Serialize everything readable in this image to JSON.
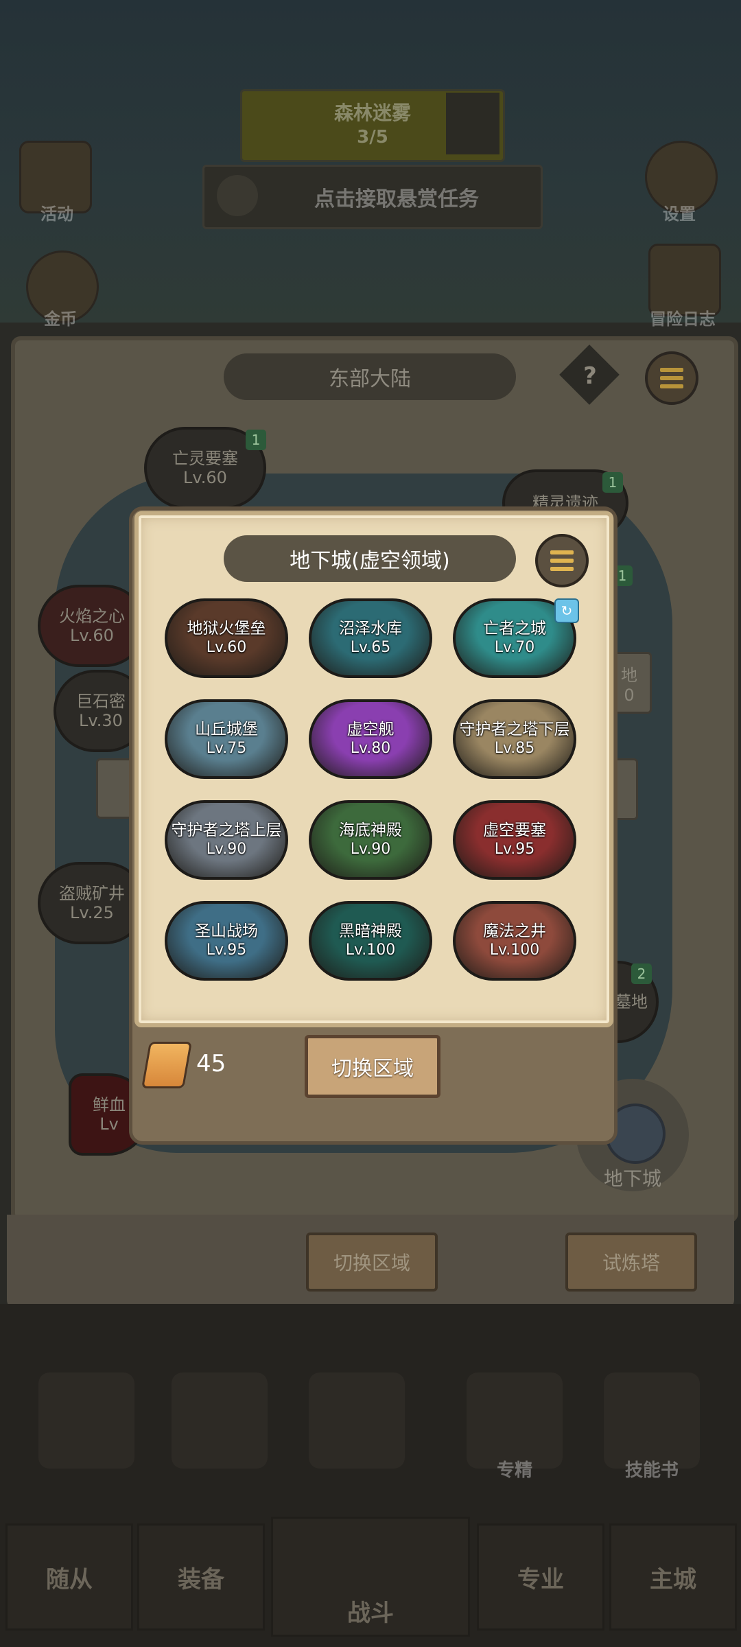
{
  "background": {
    "top_banner_line1": "森林迷雾",
    "top_banner_line2": "3/5",
    "task_bar_text": "点击接取悬赏任务",
    "left_icon_1_label": "活动",
    "left_icon_2_label": "金币",
    "right_icon_1_label": "设置",
    "right_icon_2_label": "冒险日志",
    "map_title": "东部大陆",
    "help_label": "?",
    "map_nodes": [
      {
        "name": "亡灵要塞",
        "level": "Lv.60",
        "badge": "1"
      },
      {
        "name": "精灵遗迹",
        "level": "",
        "badge": "1"
      },
      {
        "name": "火焰之心",
        "level": "Lv.60",
        "badge": ""
      },
      {
        "name": "巨石密",
        "level": "Lv.30",
        "badge": ""
      },
      {
        "name": "盗贼矿井",
        "level": "Lv.25",
        "badge": ""
      },
      {
        "name": "鲜血",
        "level": "Lv",
        "badge": ""
      },
      {
        "name": "地",
        "level": "0",
        "badge": ""
      },
      {
        "name": "墓地",
        "level": "",
        "badge": "2"
      }
    ],
    "dungeon_fab_label": "地下城",
    "lower_buttons": [
      "切换区域",
      "试炼塔"
    ],
    "bottom_skills": [
      "专精",
      "技能书"
    ],
    "nav": [
      "随从",
      "装备",
      "战斗",
      "专业",
      "主城"
    ]
  },
  "modal": {
    "title": "地下城(虚空领域)",
    "dungeons": [
      {
        "name": "地狱火堡垒",
        "level": "Lv.60",
        "color": "#5a3a2a"
      },
      {
        "name": "沼泽水库",
        "level": "Lv.65",
        "color": "#2c6b74"
      },
      {
        "name": "亡者之城",
        "level": "Lv.70",
        "color": "#2f8c8a",
        "badge": "new"
      },
      {
        "name": "山丘城堡",
        "level": "Lv.75",
        "color": "#5a7f8f"
      },
      {
        "name": "虚空舰",
        "level": "Lv.80",
        "color": "#8a3fb0"
      },
      {
        "name": "守护者之塔下层",
        "level": "Lv.85",
        "color": "#9a8662"
      },
      {
        "name": "守护者之塔上层",
        "level": "Lv.90",
        "color": "#6d7680"
      },
      {
        "name": "海底神殿",
        "level": "Lv.90",
        "color": "#3d6a3c"
      },
      {
        "name": "虚空要塞",
        "level": "Lv.95",
        "color": "#8a2e2e"
      },
      {
        "name": "圣山战场",
        "level": "Lv.95",
        "color": "#3f6e86"
      },
      {
        "name": "黑暗神殿",
        "level": "Lv.100",
        "color": "#1f5a52"
      },
      {
        "name": "魔法之井",
        "level": "Lv.100",
        "color": "#8e4a3c"
      }
    ],
    "scroll_count": "45",
    "switch_button": "切换区域"
  }
}
